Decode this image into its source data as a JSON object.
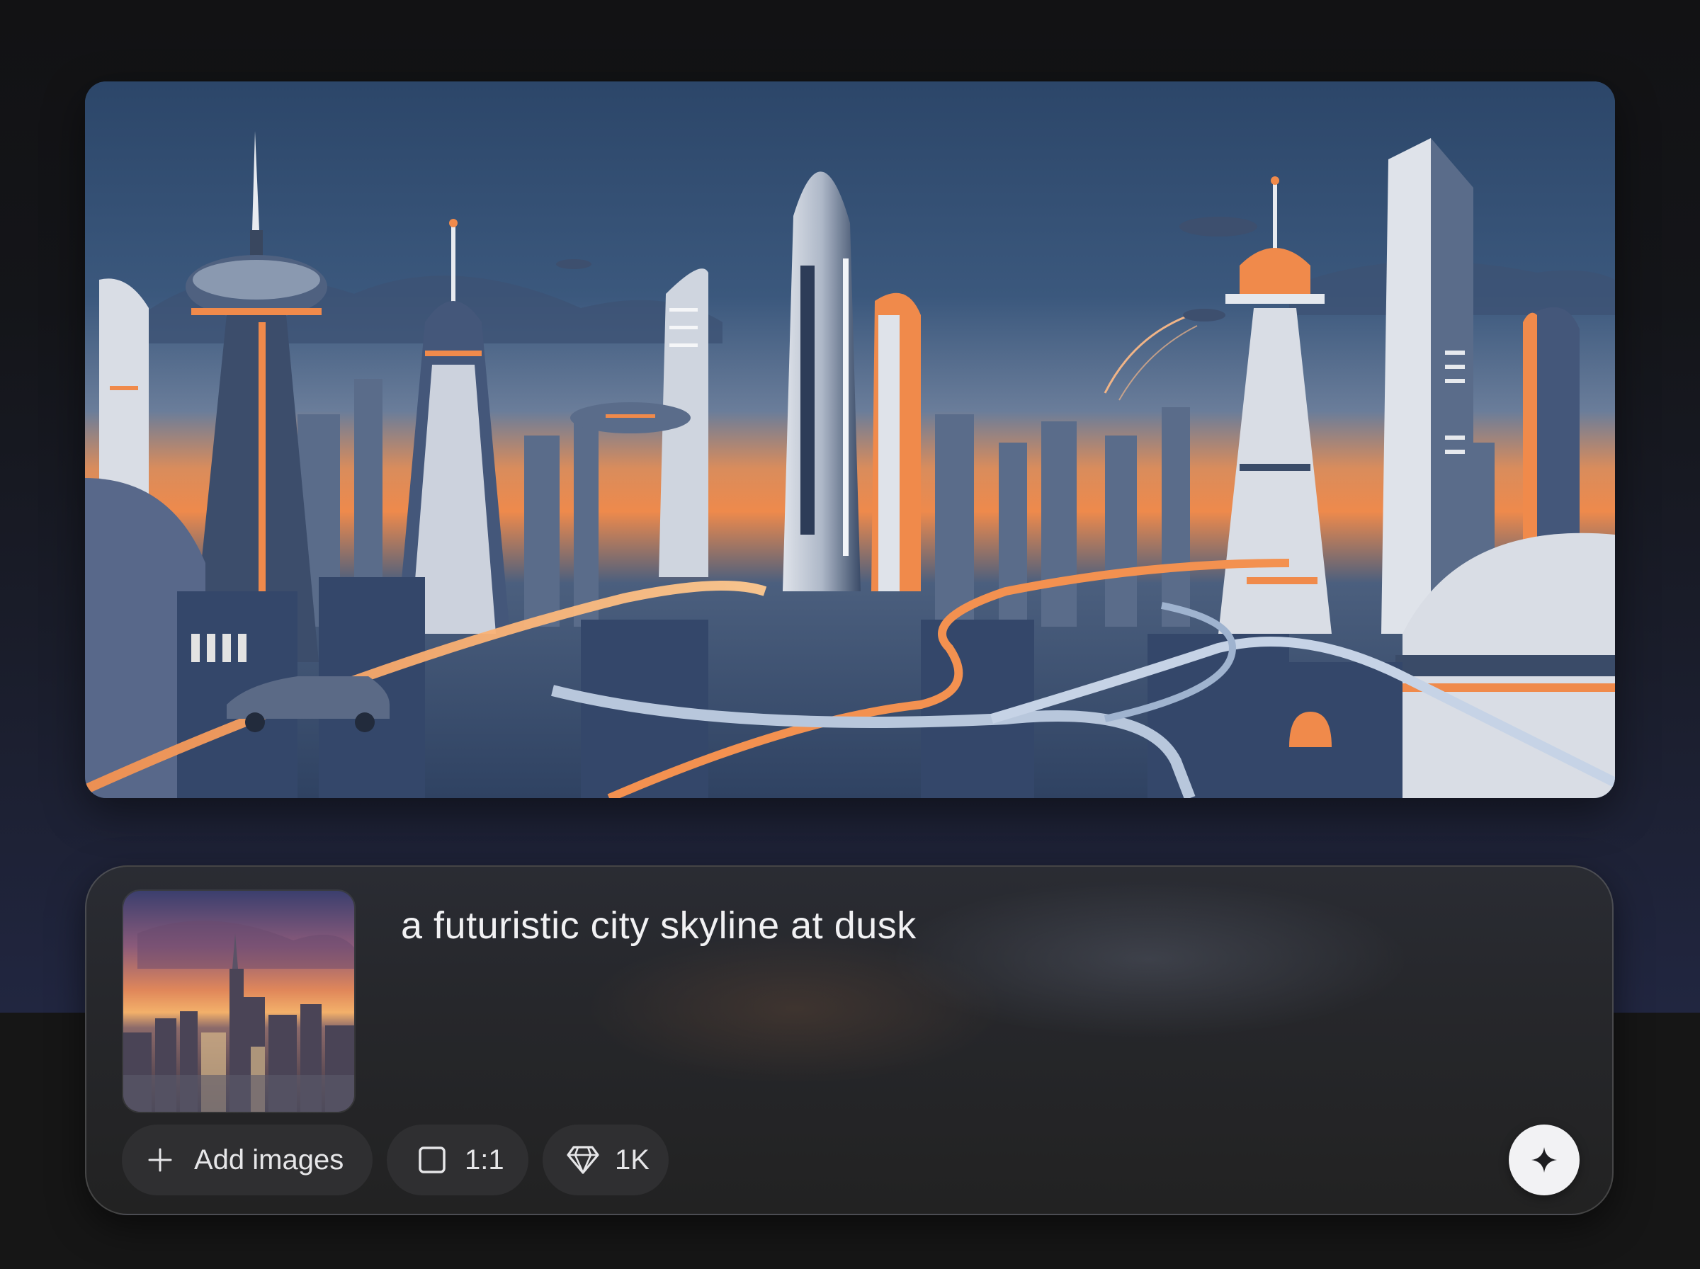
{
  "generated_image": {
    "alt": "a futuristic city skyline at dusk"
  },
  "composer": {
    "reference_image_alt": "a futuristic city skyline at dusk",
    "prompt": "a futuristic city skyline at dusk",
    "add_images_label": "Add images",
    "aspect_ratio_label": "1:1",
    "quality_label": "1K",
    "icons": {
      "add": "plus-icon",
      "aspect_ratio": "square-icon",
      "quality": "diamond-icon",
      "generate": "sparkle-icon"
    }
  },
  "colors": {
    "sky_top": "#2c4669",
    "sky_horizon": "#e98b4f",
    "accent_orange": "#f08a4b",
    "chip_bg": "#2f2f31",
    "generate_bg": "#f2f2f4"
  }
}
